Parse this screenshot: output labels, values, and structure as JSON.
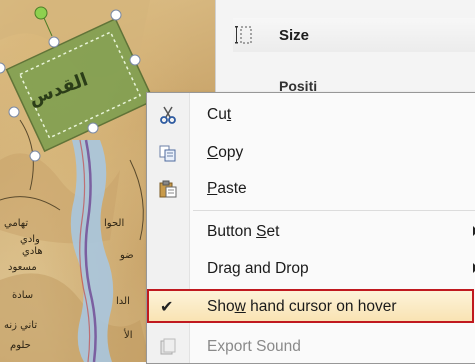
{
  "ribbon": {
    "size_label": "Size",
    "position_label": "Positi"
  },
  "map": {
    "selected_shape_label": "القدس",
    "labels": [
      "تهامي",
      "الحوا",
      "وادي",
      "هادي",
      "مسعود",
      "ضو",
      "سادة",
      "الدا",
      "تاني زنه",
      "الأ",
      "حلوم"
    ]
  },
  "context_menu": {
    "items": [
      {
        "label_pre": "Cu",
        "label_key": "t",
        "label_post": "",
        "icon": "scissors-icon",
        "submenu": false
      },
      {
        "label_pre": "",
        "label_key": "C",
        "label_post": "opy",
        "icon": "copy-icon",
        "submenu": false
      },
      {
        "label_pre": "",
        "label_key": "P",
        "label_post": "aste",
        "icon": "paste-icon",
        "submenu": false
      },
      {
        "label_pre": "Button ",
        "label_key": "S",
        "label_post": "et",
        "icon": "",
        "submenu": true
      },
      {
        "label_pre": "Drag and Drop",
        "label_key": "",
        "label_post": "",
        "icon": "",
        "submenu": true
      },
      {
        "label_pre": "Sho",
        "label_key": "w",
        "label_post": " hand cursor on hover",
        "icon": "checkmark-icon",
        "checked": true,
        "submenu": false
      },
      {
        "label_pre": "Export Sound",
        "label_key": "",
        "label_post": "",
        "icon": "export-sound-icon",
        "disabled": true,
        "submenu": false
      }
    ],
    "check_glyph": "✔"
  },
  "colors": {
    "highlight_border": "#c0191f",
    "selection_fill": "#5e8f3a"
  }
}
